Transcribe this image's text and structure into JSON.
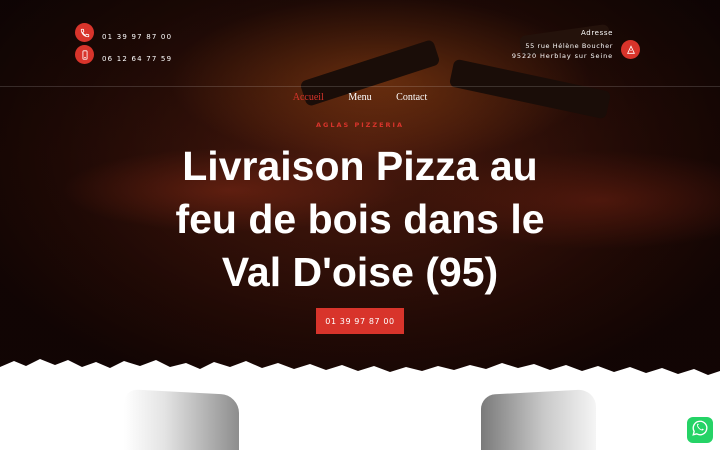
{
  "header": {
    "phone_primary": "01 39 97 87 00",
    "phone_secondary": "06 12 64 77 59",
    "address_label": "Adresse",
    "address_line1": "55 rue Hélène Boucher",
    "address_line2": "95220 Herblay sur Seine"
  },
  "nav": {
    "items": [
      {
        "label": "Accueil",
        "active": true
      },
      {
        "label": "Menu",
        "active": false
      },
      {
        "label": "Contact",
        "active": false
      }
    ]
  },
  "hero": {
    "kicker": "AGLAS PIZZERIA",
    "title_line1": "Livraison Pizza au",
    "title_line2": "feu de bois dans le",
    "title_line3": "Val D'oise (95)",
    "cta_label": "01 39 97 87 00"
  },
  "icons": {
    "phone": "phone-icon",
    "mobile": "mobile-phone-icon",
    "address": "pizza-slice-icon",
    "chat": "whatsapp-icon"
  },
  "colors": {
    "accent": "#d8342b",
    "whatsapp": "#25d366"
  }
}
